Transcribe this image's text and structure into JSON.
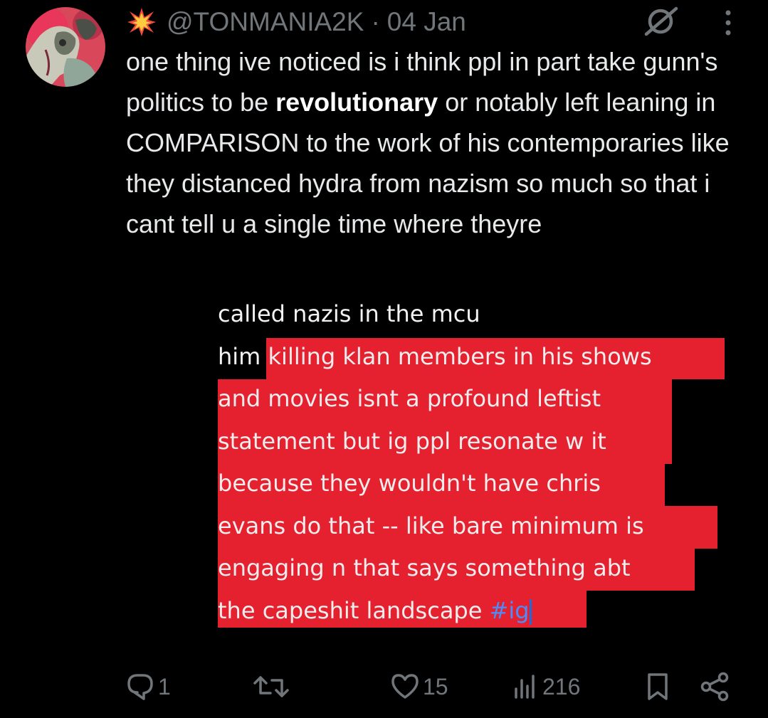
{
  "tweet": {
    "handle": "@TONMANIA2K",
    "separator": "·",
    "date": "04 Jan",
    "text_part1": "one thing ive noticed is i think ppl in part take gunn's politics to be ",
    "text_bold": "revolutionary",
    "text_part2": " or notably left leaning in COMPARISON to the work of his contemporaries like they distanced hydra from nazism so much so that i cant tell u a single time where theyre"
  },
  "image_text": {
    "line1": "called nazis in the mcu",
    "line2_plain": "him ",
    "line2_marked": "killing klan members in his shows",
    "line3": "and movies isnt a profound leftist",
    "line4": "statement but ig ppl resonate w it",
    "line5": "because they wouldn't have chris",
    "line6": "evans do that -- like bare minimum is",
    "line7": "engaging n that says something abt",
    "line8_plain": "the capeshit landscape ",
    "hashtag": "#ig"
  },
  "actions": {
    "replies": "1",
    "reposts": "",
    "likes": "15",
    "views": "216"
  },
  "colors": {
    "background": "#000000",
    "text": "#e7e9ea",
    "muted": "#71767b",
    "highlight": "#e5202f",
    "hashtag": "#4b8cf7"
  },
  "icons": {
    "header_emoji": "collision-emoji-icon",
    "grok": "grok-icon",
    "more": "more-vertical-icon",
    "reply": "reply-icon",
    "repost": "repost-icon",
    "like": "heart-icon",
    "views": "views-chart-icon",
    "bookmark": "bookmark-icon",
    "share": "share-icon"
  }
}
